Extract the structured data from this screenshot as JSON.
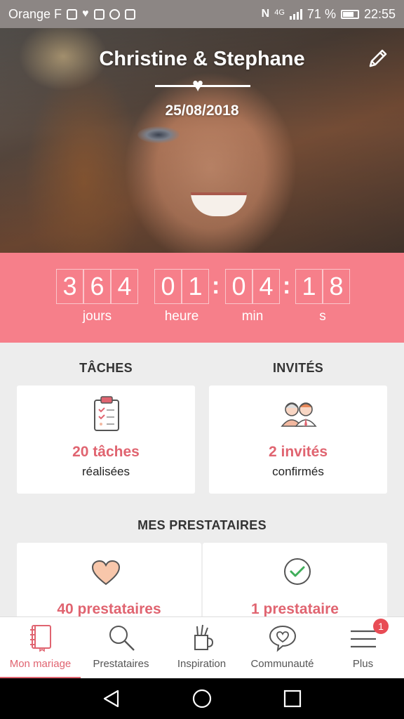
{
  "status_bar": {
    "carrier": "Orange F",
    "network": "4G",
    "battery": "71 %",
    "time": "22:55"
  },
  "hero": {
    "title": "Christine & Stephane",
    "date": "25/08/2018"
  },
  "countdown": {
    "days": [
      "3",
      "6",
      "4"
    ],
    "hours": [
      "0",
      "1"
    ],
    "minutes": [
      "0",
      "4"
    ],
    "seconds": [
      "1",
      "8"
    ],
    "days_label": "jours",
    "hours_label": "heure",
    "minutes_label": "min",
    "seconds_label": "s"
  },
  "tasks": {
    "title": "TÂCHES",
    "count": "20 tâches",
    "sub": "réalisées",
    "icon": "clipboard-icon"
  },
  "guests": {
    "title": "INVITÉS",
    "count": "2 invités",
    "sub": "confirmés",
    "icon": "guests-icon"
  },
  "providers": {
    "title": "MES PRESTATAIRES",
    "left_count": "40 prestataires",
    "right_count": "1 prestataire",
    "left_icon": "heart-icon",
    "right_icon": "check-circle-icon"
  },
  "bottom_nav": {
    "items": [
      {
        "label": "Mon mariage",
        "icon": "notebook-icon"
      },
      {
        "label": "Prestataires",
        "icon": "search-icon"
      },
      {
        "label": "Inspiration",
        "icon": "brush-cup-icon"
      },
      {
        "label": "Communauté",
        "icon": "chat-heart-icon"
      },
      {
        "label": "Plus",
        "icon": "menu-icon",
        "badge": "1"
      }
    ]
  },
  "colors": {
    "accent": "#e06470",
    "countdown_bg": "#f67f8a",
    "page_bg": "#ededed"
  }
}
